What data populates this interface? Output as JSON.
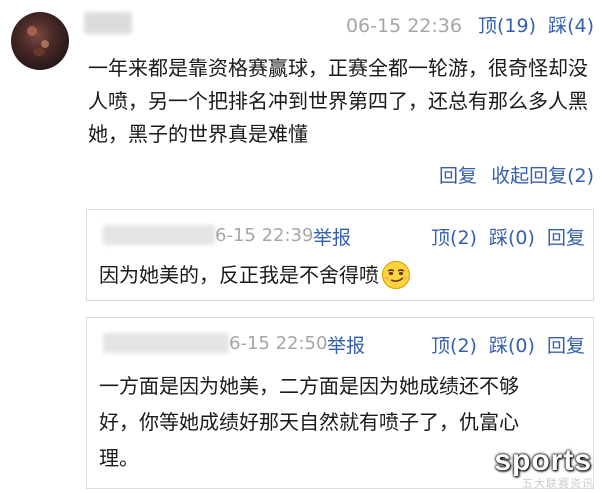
{
  "comment": {
    "time": "06-15 22:36",
    "up": "顶(19)",
    "down": "踩(4)",
    "text": "一年来都是靠资格赛赢球，正赛全都一轮游，很奇怪却没人喷，另一个把排名冲到世界第四了，还总有那么多人黑她，黑子的世界真是难懂",
    "reply_label": "回复",
    "collapse_label": "收起回复(2)"
  },
  "replies": [
    {
      "time": "6-15 22:39",
      "report": "举报",
      "up": "顶(2)",
      "down": "踩(0)",
      "reply_label": "回复",
      "text": "因为她美的，反正我是不舍得喷",
      "emoji": "smirk-emoji"
    },
    {
      "time": "6-15 22:50",
      "report": "举报",
      "up": "顶(2)",
      "down": "踩(0)",
      "reply_label": "回复",
      "text_lines": [
        "一方面是因为她美，二方面是因为她成绩还不够",
        "好，你等她成绩好那天自然就有喷子了，仇富心",
        "理。"
      ]
    }
  ],
  "watermark": {
    "main": "sports",
    "sub": "五大联赛资讯"
  },
  "colors": {
    "link": "#3560b0",
    "meta": "#a6a6a6",
    "text": "#1a1a1a",
    "border": "#dcdcdc"
  }
}
